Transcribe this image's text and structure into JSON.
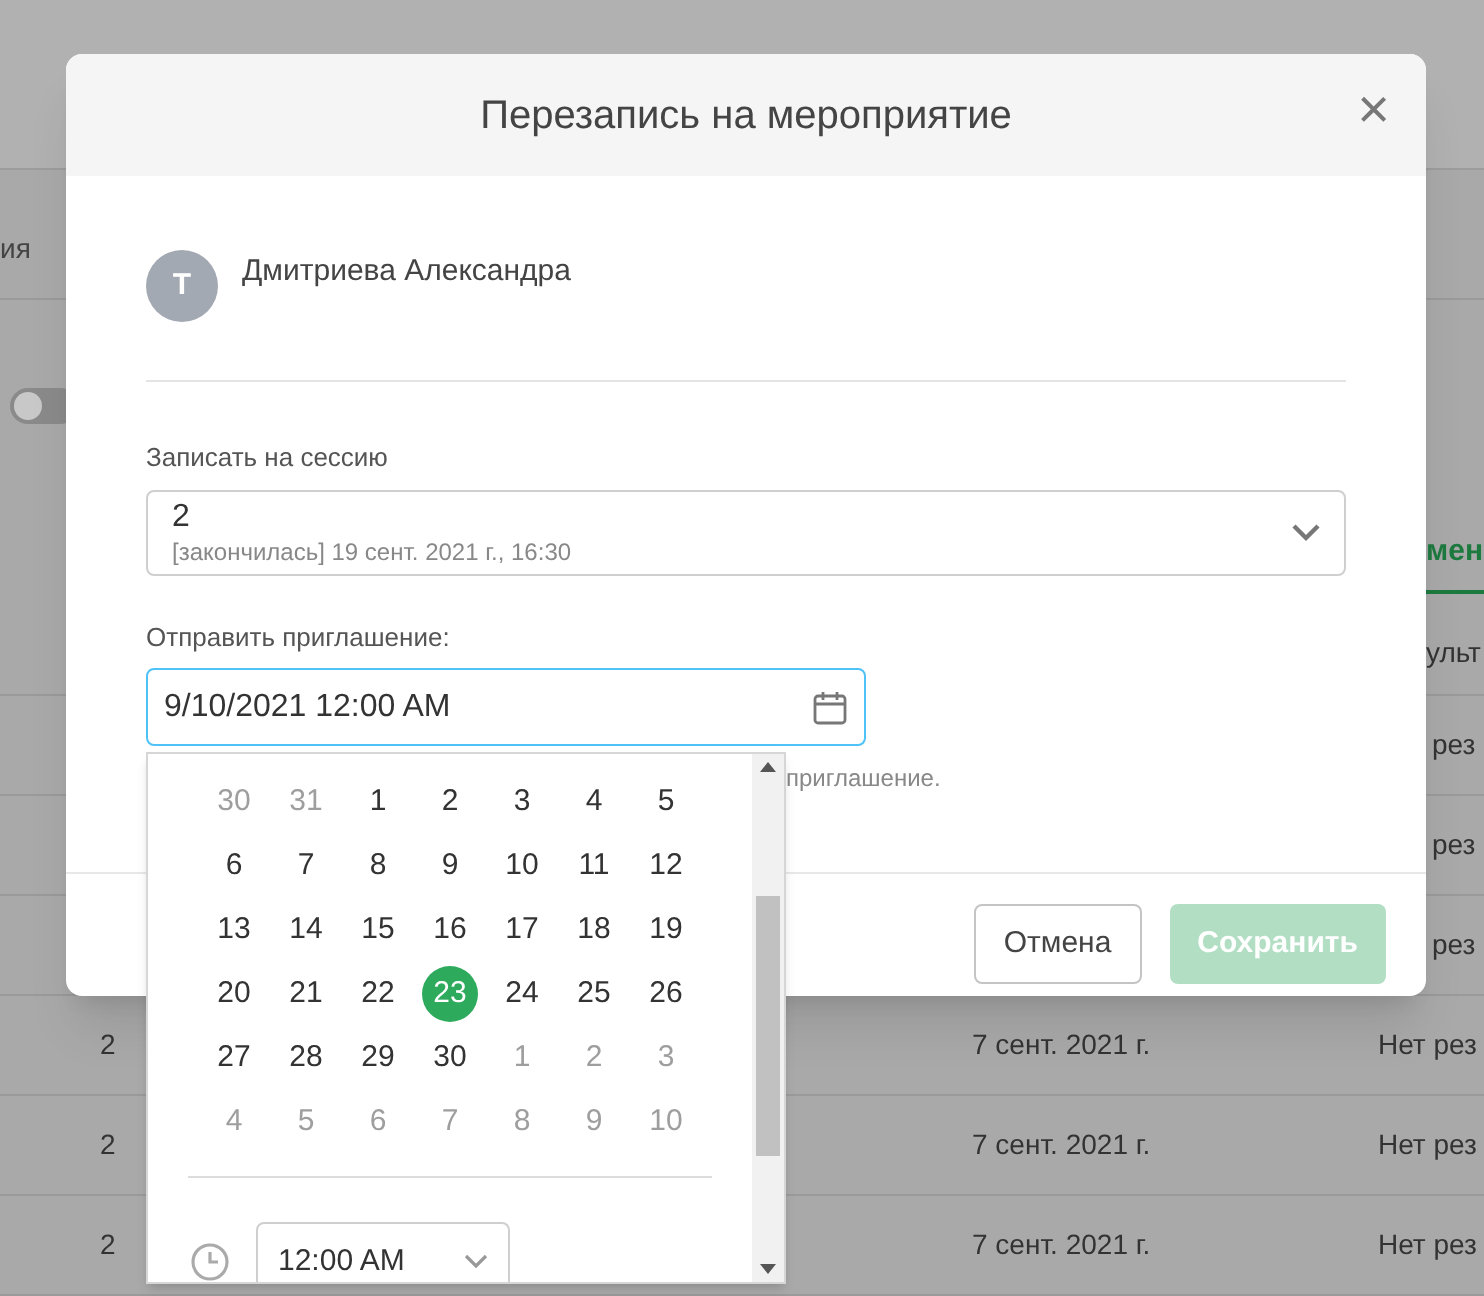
{
  "background": {
    "header_cell": "ия",
    "toggle": {
      "on": false
    },
    "tab": "мен",
    "column_header": "ульт",
    "partial_rows": [
      "рез",
      "рез",
      "рез"
    ],
    "rows": [
      {
        "column_1": "2",
        "column_2": "7 сент. 2021 г.",
        "column_3": "Нет рез"
      },
      {
        "column_1": "2",
        "column_2": "7 сент. 2021 г.",
        "column_3": "Нет рез"
      },
      {
        "column_1": "2",
        "column_2": "7 сент. 2021 г.",
        "column_3": "Нет рез"
      }
    ]
  },
  "dialog": {
    "title": "Перезапись на мероприятие",
    "close": "×",
    "person": {
      "initial": "Т",
      "name": "Дмитриева Александра"
    },
    "session": {
      "label": "Записать на сессию",
      "value": "2",
      "detail": "[закончилась] 19 сент. 2021 г., 16:30"
    },
    "invitation": {
      "label": "Отправить приглашение:",
      "value": "9/10/2021 12:00 AM",
      "hint": "приглашение."
    },
    "buttons": [
      {
        "label": "Отмена",
        "kind": "secondary",
        "disabled": false
      },
      {
        "label": "Сохранить",
        "kind": "primary",
        "disabled": true
      }
    ]
  },
  "date_picker": {
    "days": [
      {
        "label": "30",
        "outside": true,
        "selected": false
      },
      {
        "label": "31",
        "outside": true,
        "selected": false
      },
      {
        "label": "1",
        "outside": false,
        "selected": false
      },
      {
        "label": "2",
        "outside": false,
        "selected": false
      },
      {
        "label": "3",
        "outside": false,
        "selected": false
      },
      {
        "label": "4",
        "outside": false,
        "selected": false
      },
      {
        "label": "5",
        "outside": false,
        "selected": false
      },
      {
        "label": "6",
        "outside": false,
        "selected": false
      },
      {
        "label": "7",
        "outside": false,
        "selected": false
      },
      {
        "label": "8",
        "outside": false,
        "selected": false
      },
      {
        "label": "9",
        "outside": false,
        "selected": false
      },
      {
        "label": "10",
        "outside": false,
        "selected": false
      },
      {
        "label": "11",
        "outside": false,
        "selected": false
      },
      {
        "label": "12",
        "outside": false,
        "selected": false
      },
      {
        "label": "13",
        "outside": false,
        "selected": false
      },
      {
        "label": "14",
        "outside": false,
        "selected": false
      },
      {
        "label": "15",
        "outside": false,
        "selected": false
      },
      {
        "label": "16",
        "outside": false,
        "selected": false
      },
      {
        "label": "17",
        "outside": false,
        "selected": false
      },
      {
        "label": "18",
        "outside": false,
        "selected": false
      },
      {
        "label": "19",
        "outside": false,
        "selected": false
      },
      {
        "label": "20",
        "outside": false,
        "selected": false
      },
      {
        "label": "21",
        "outside": false,
        "selected": false
      },
      {
        "label": "22",
        "outside": false,
        "selected": false
      },
      {
        "label": "23",
        "outside": false,
        "selected": true
      },
      {
        "label": "24",
        "outside": false,
        "selected": false
      },
      {
        "label": "25",
        "outside": false,
        "selected": false
      },
      {
        "label": "26",
        "outside": false,
        "selected": false
      },
      {
        "label": "27",
        "outside": false,
        "selected": false
      },
      {
        "label": "28",
        "outside": false,
        "selected": false
      },
      {
        "label": "29",
        "outside": false,
        "selected": false
      },
      {
        "label": "30",
        "outside": false,
        "selected": false
      },
      {
        "label": "1",
        "outside": true,
        "selected": false
      },
      {
        "label": "2",
        "outside": true,
        "selected": false
      },
      {
        "label": "3",
        "outside": true,
        "selected": false
      },
      {
        "label": "4",
        "outside": true,
        "selected": false
      },
      {
        "label": "5",
        "outside": true,
        "selected": false
      },
      {
        "label": "6",
        "outside": true,
        "selected": false
      },
      {
        "label": "7",
        "outside": true,
        "selected": false
      },
      {
        "label": "8",
        "outside": true,
        "selected": false
      },
      {
        "label": "9",
        "outside": true,
        "selected": false
      },
      {
        "label": "10",
        "outside": true,
        "selected": false
      }
    ],
    "time": "12:00 AM"
  }
}
